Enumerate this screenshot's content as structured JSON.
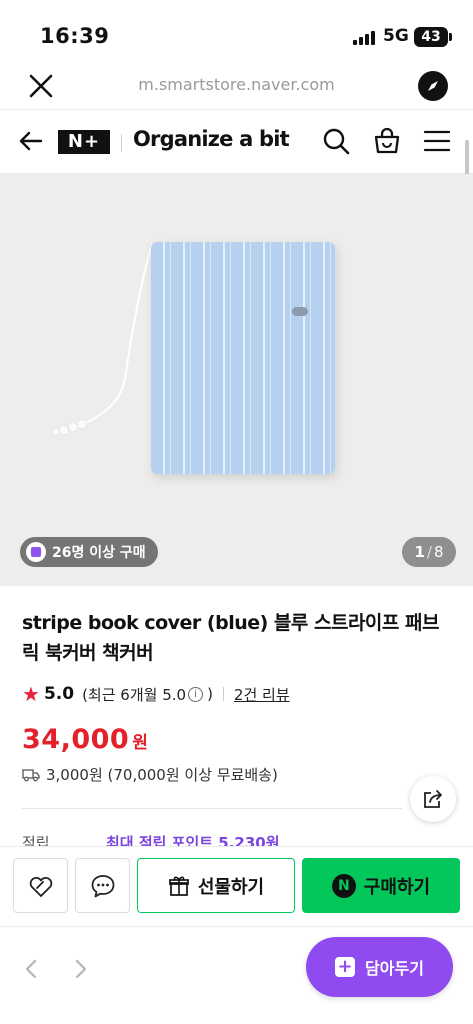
{
  "status_bar": {
    "time": "16:39",
    "network": "5G",
    "battery": "43"
  },
  "browser": {
    "url": "m.smartstore.naver.com"
  },
  "header": {
    "logo": "N+",
    "store_name": "Organize a bit"
  },
  "gallery": {
    "buyers_badge": "26명 이상 구매",
    "current_page": "1",
    "total_pages": "8",
    "separator": "/"
  },
  "product": {
    "title": "stripe book cover (blue) 블루 스트라이프 패브릭 북커버 책커버",
    "rating": "5.0",
    "rating_recent": "(최근 6개월 5.0",
    "rating_recent_close": ")",
    "review_count": "2건 리뷰",
    "price": "34,000",
    "price_unit": "원",
    "shipping": "3,000원 (70,000원 이상 무료배송)",
    "points_label": "적립",
    "points_value": "최대 적립 포인트 5,230원"
  },
  "actions": {
    "gift_label": "선물하기",
    "buy_label": "구매하기",
    "buy_icon": "N"
  },
  "browser_bottom": {
    "save_label": "담아두기"
  },
  "colors": {
    "accent_green": "#03c75a",
    "price_red": "#e4212b",
    "purple": "#8f4bf0"
  }
}
